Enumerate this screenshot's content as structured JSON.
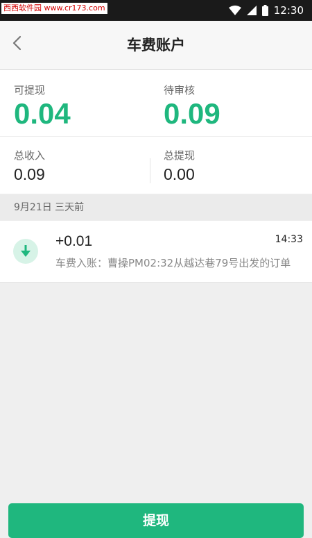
{
  "status_bar": {
    "watermark": "西西软件园 www.cr173.com",
    "time": "12:30"
  },
  "nav": {
    "title": "车费账户"
  },
  "balance": {
    "withdrawable_label": "可提现",
    "withdrawable_value": "0.04",
    "pending_label": "待审核",
    "pending_value": "0.09",
    "total_income_label": "总收入",
    "total_income_value": "0.09",
    "total_withdrawn_label": "总提现",
    "total_withdrawn_value": "0.00"
  },
  "records": {
    "date_header": "9月21日 三天前",
    "items": [
      {
        "icon": "download-arrow-icon",
        "amount": "+0.01",
        "time": "14:33",
        "description": "车费入账：曹操PM02:32从越达巷79号出发的订单"
      }
    ]
  },
  "actions": {
    "withdraw_label": "提现"
  },
  "colors": {
    "accent": "#1fb77e",
    "status_bar": "#1a1a1a",
    "background": "#efefef"
  }
}
